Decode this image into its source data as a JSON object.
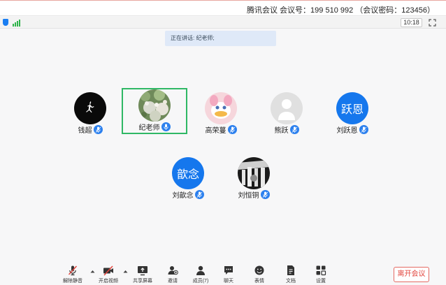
{
  "window": {
    "title": "腾讯会议 会议号：199 510 992 （会议密码：123456）"
  },
  "status": {
    "time": "10:18"
  },
  "speaking_text": "正在讲话: 纪老师;",
  "participants": [
    {
      "name": "钱超",
      "avatar": "logo-avatar"
    },
    {
      "name": "纪老师",
      "avatar": "photo-avatar",
      "speaking": true
    },
    {
      "name": "高荣蔓",
      "avatar": "cartoon-avatar"
    },
    {
      "name": "熊跃",
      "avatar": "default-avatar"
    },
    {
      "name": "刘跃恩",
      "avatar": "initials-avatar",
      "initials": "跃恩"
    },
    {
      "name": "刘歆念",
      "avatar": "initials-avatar",
      "initials": "歆念"
    },
    {
      "name": "刘恒铜",
      "avatar": "photo-avatar"
    }
  ],
  "toolbar": {
    "unmute": "解除静音",
    "video": "开启视频",
    "share": "共享屏幕",
    "invite": "邀请",
    "members": "成员(7)",
    "chat": "聊天",
    "emoji": "表情",
    "docs": "文档",
    "settings": "设置",
    "leave": "离开会议"
  },
  "colors": {
    "accent": "#1577ed",
    "active_border": "#2fb865",
    "leave": "#e2463e",
    "signal": "#2fb34a"
  }
}
